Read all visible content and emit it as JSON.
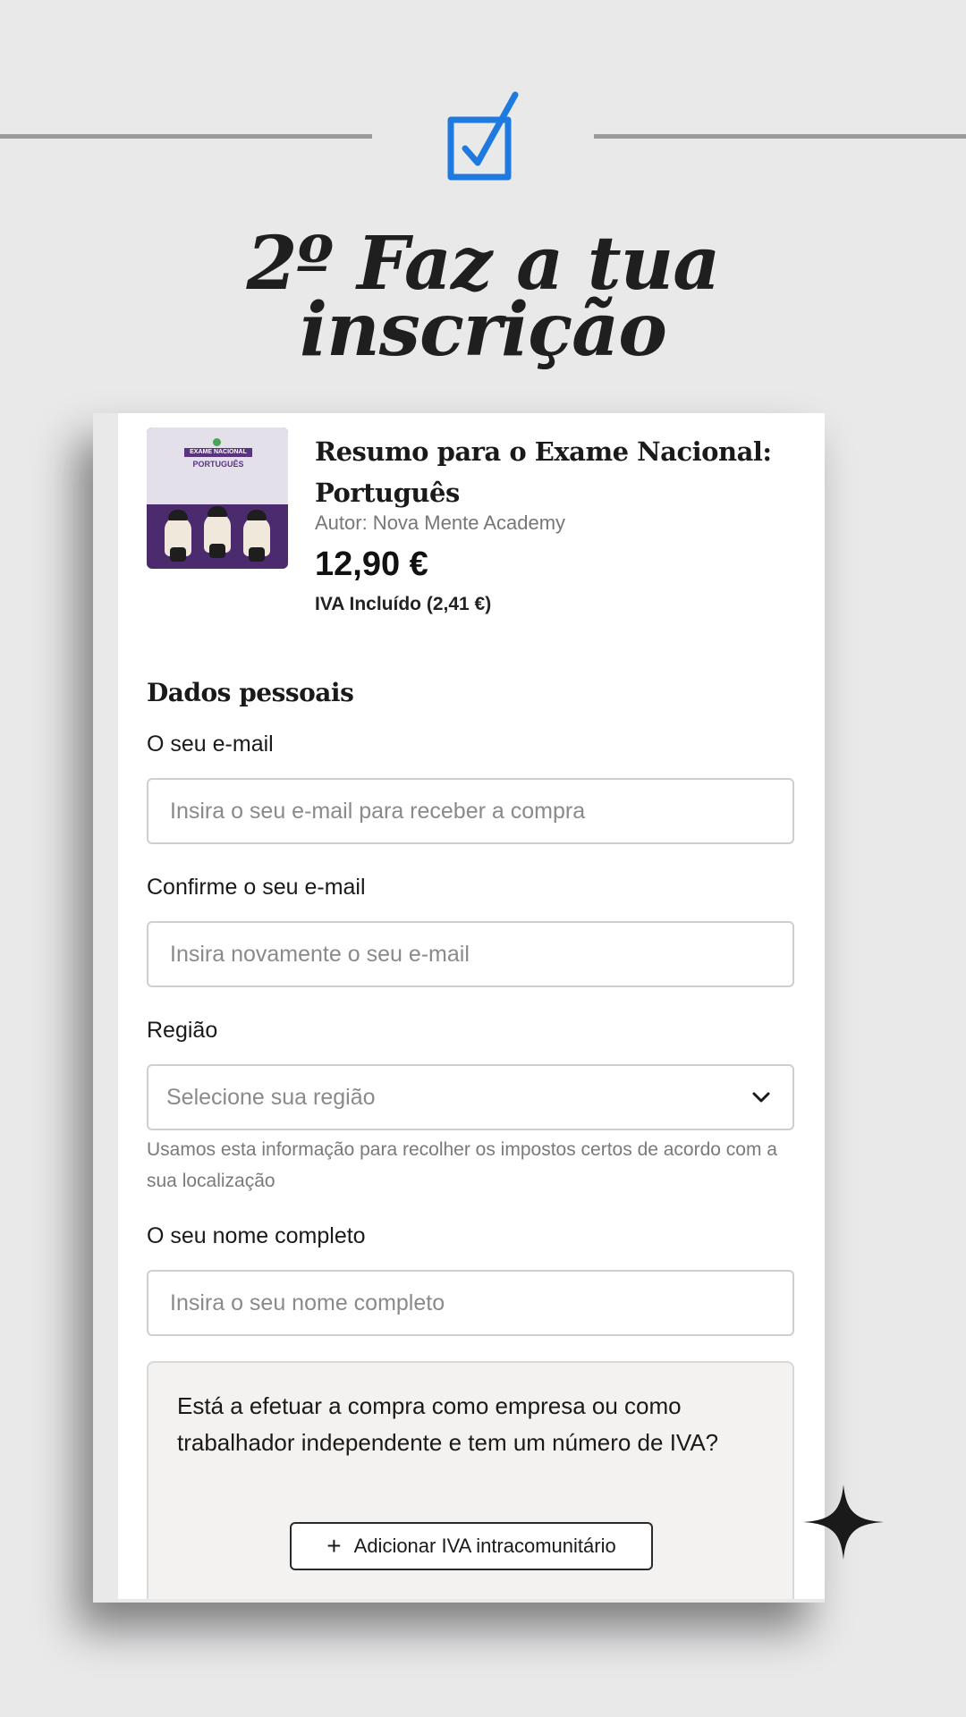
{
  "headline": {
    "line1": "2º Faz a tua",
    "line2": "inscrição"
  },
  "product": {
    "thumbnail": {
      "tag1": "EXAME NACIONAL",
      "tag2": "PORTUGUÊS"
    },
    "title": "Resumo para o Exame Nacional: Português",
    "author": "Autor: Nova Mente Academy",
    "price": "12,90 €",
    "vat_included": "IVA Incluído (2,41 €)"
  },
  "personal": {
    "section_title": "Dados pessoais",
    "email_label": "O seu e-mail",
    "email_placeholder": "Insira o seu e-mail para receber a compra",
    "confirm_label": "Confirme o seu e-mail",
    "confirm_placeholder": "Insira novamente o seu e-mail",
    "region_label": "Região",
    "region_selected": "Selecione sua região",
    "region_help": "Usamos esta informação para recolher os impostos certos de acordo com a sua localização",
    "name_label": "O seu nome completo",
    "name_placeholder": "Insira o seu nome completo"
  },
  "vat": {
    "question": "Está a efetuar a compra como empresa ou como trabalhador independente e tem um número de IVA?",
    "button_label": "Adicionar IVA intracomunitário"
  },
  "icons": {
    "check": "checkbox-check-icon",
    "chevron": "chevron-down-icon",
    "plus": "plus-icon",
    "sparkle": "sparkle-icon"
  },
  "colors": {
    "background": "#e9e9ea",
    "check_blue": "#1f7ae0",
    "thumbnail_purple": "#4b2a6e"
  }
}
